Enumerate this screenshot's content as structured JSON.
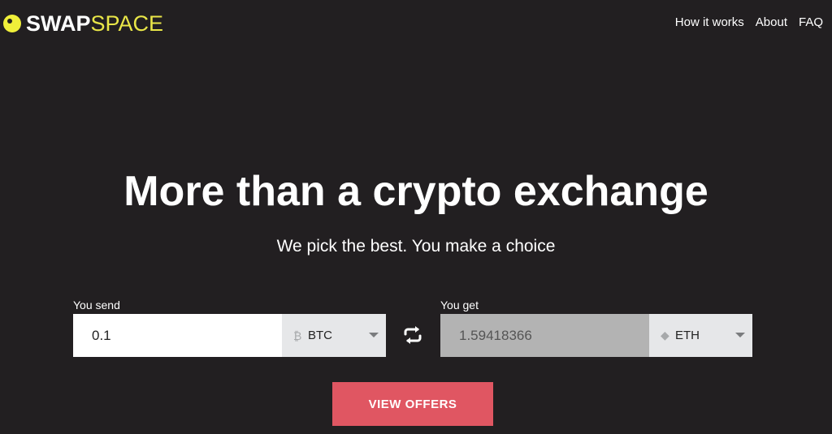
{
  "brand": {
    "name_bold": "SWAP",
    "name_light": "SPACE",
    "accent_color": "#e9e648",
    "icon": "logo-dot-icon"
  },
  "nav": {
    "items": [
      {
        "label": "How it works"
      },
      {
        "label": "About"
      },
      {
        "label": "FAQ"
      }
    ]
  },
  "hero": {
    "title": "More than a crypto exchange",
    "subtitle": "We pick the best. You make a choice"
  },
  "exchange": {
    "send": {
      "label": "You send",
      "value": "0.1",
      "currency": "BTC",
      "currency_icon": "bitcoin-icon"
    },
    "get": {
      "label": "You get",
      "value": "1.59418366",
      "currency": "ETH",
      "currency_icon": "ethereum-icon"
    },
    "swap_icon": "swap-arrows-icon"
  },
  "cta": {
    "label": "VIEW OFFERS",
    "color": "#e05662"
  },
  "colors": {
    "background": "#221f21"
  }
}
